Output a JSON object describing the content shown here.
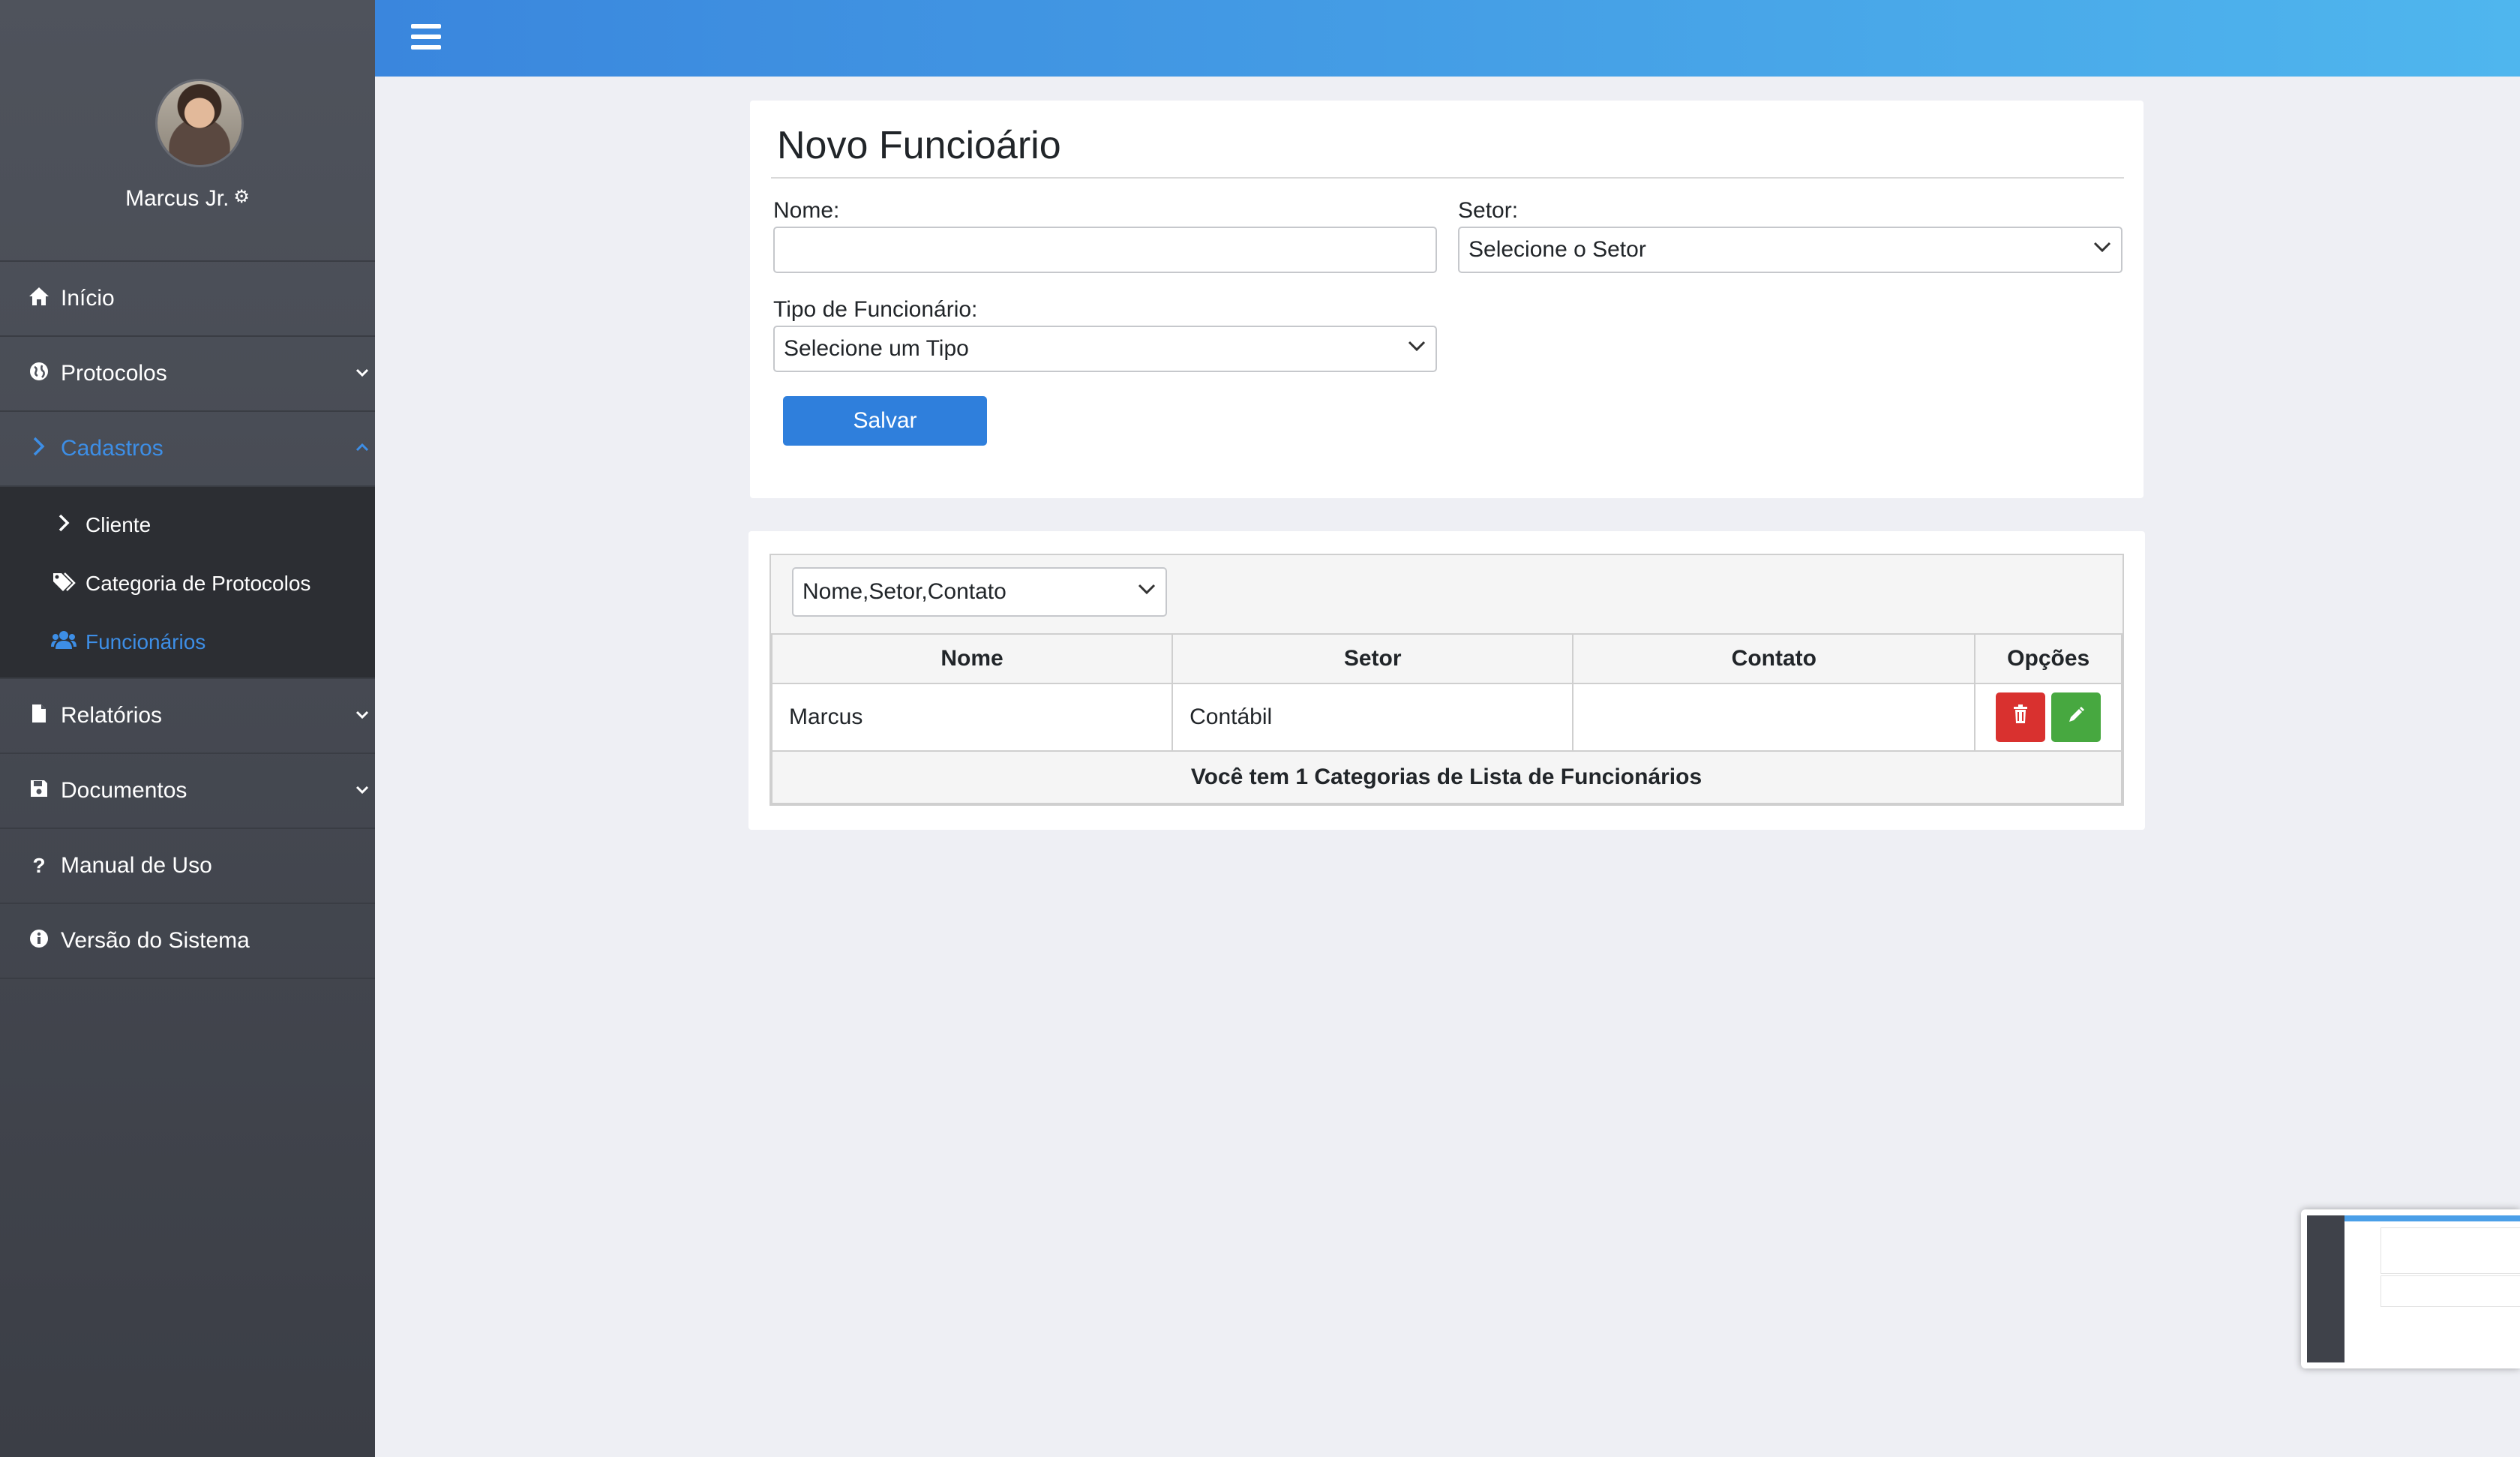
{
  "sidebar": {
    "user_name": "Marcus Jr.",
    "items": [
      {
        "label": "Início"
      },
      {
        "label": "Protocolos"
      },
      {
        "label": "Cadastros"
      },
      {
        "label": "Relatórios"
      },
      {
        "label": "Documentos"
      },
      {
        "label": "Manual de Uso"
      },
      {
        "label": "Versão do Sistema"
      }
    ],
    "submenu": [
      {
        "label": "Cliente"
      },
      {
        "label": "Categoria de Protocolos"
      },
      {
        "label": "Funcionários"
      }
    ]
  },
  "form": {
    "title": "Novo Funcioário",
    "nome_label": "Nome:",
    "nome_value": "",
    "setor_label": "Setor:",
    "setor_selected": "Selecione o Setor",
    "tipo_label": "Tipo de Funcionário:",
    "tipo_selected": "Selecione um Tipo",
    "save_label": "Salvar"
  },
  "list": {
    "filter_selected": "Nome,Setor,Contato",
    "columns": [
      "Nome",
      "Setor",
      "Contato",
      "Opções"
    ],
    "rows": [
      {
        "nome": "Marcus",
        "setor": "Contábil",
        "contato": ""
      }
    ],
    "footer": "Você tem 1 Categorias de Lista de Funcionários"
  },
  "colors": {
    "accent": "#3d8ee6",
    "topbar_start": "#3a86dd",
    "topbar_end": "#4fb6ee",
    "delete": "#d9312f",
    "edit": "#47a840",
    "save": "#2f7fdc"
  },
  "icons": [
    "bars-icon",
    "gear-icon",
    "home-icon",
    "globe-icon",
    "chevron-right-icon",
    "tags-icon",
    "users-icon",
    "file-icon",
    "save-icon",
    "question-icon",
    "info-icon",
    "chevron-down-icon",
    "trash-icon",
    "pencil-icon"
  ]
}
